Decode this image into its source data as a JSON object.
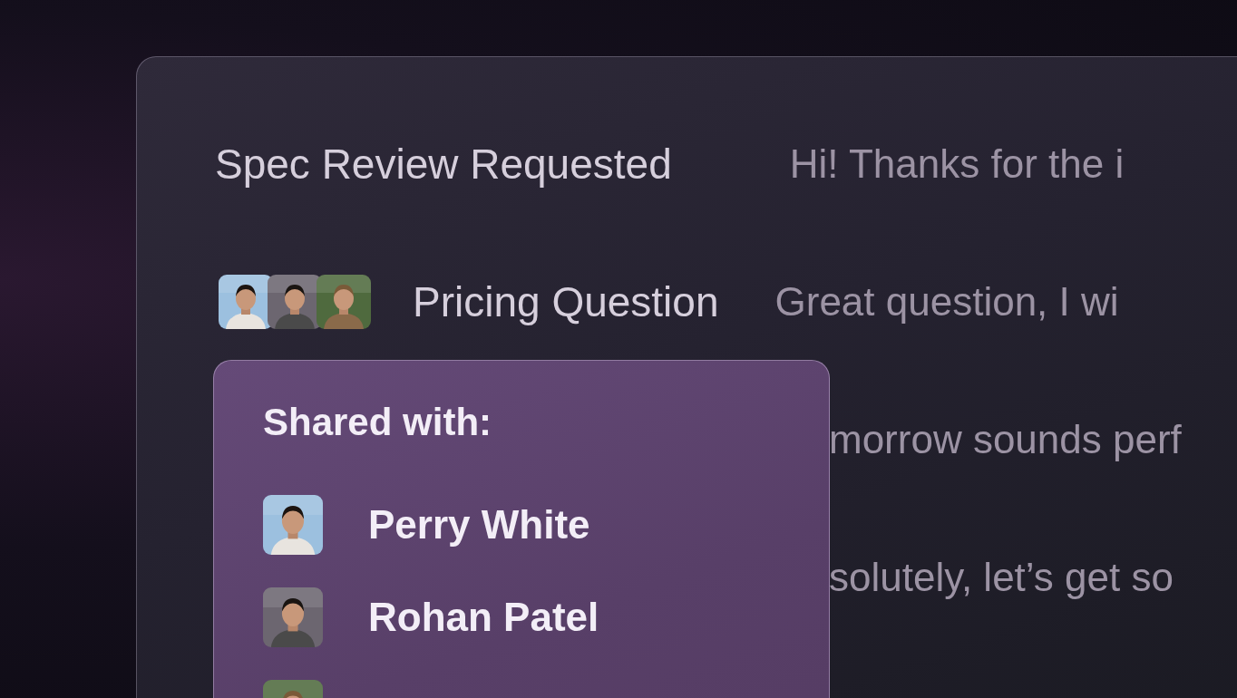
{
  "threads": [
    {
      "title": "Spec Review Requested",
      "preview": "Hi! Thanks for the i"
    },
    {
      "title": "Pricing Question",
      "preview": "Great question, I wi",
      "participants": [
        {
          "kind": "picture"
        },
        {
          "kind": "picture"
        },
        {
          "kind": "picture"
        }
      ]
    },
    {
      "preview": "morrow sounds perf"
    },
    {
      "preview": "solutely, let’s get so"
    }
  ],
  "share_popup": {
    "heading": "Shared with:",
    "people": [
      {
        "kind": "picture",
        "name": "Perry White"
      },
      {
        "kind": "picture",
        "name": "Rohan Patel"
      },
      {
        "kind": "picture"
      }
    ]
  }
}
